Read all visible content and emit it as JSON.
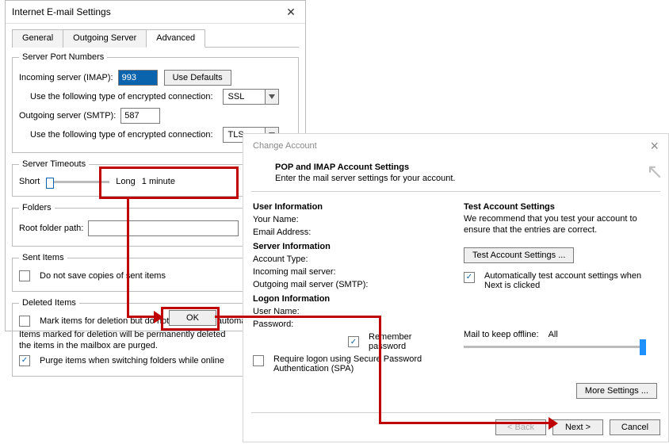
{
  "dlg1": {
    "title": "Internet E-mail Settings",
    "tabs": [
      "General",
      "Outgoing Server",
      "Advanced"
    ],
    "spn": {
      "legend": "Server Port Numbers",
      "incoming_label": "Incoming server (IMAP):",
      "incoming_value": "993",
      "use_defaults": "Use Defaults",
      "enc_label": "Use the following type of encrypted connection:",
      "enc_in": "SSL",
      "outgoing_label": "Outgoing server (SMTP):",
      "outgoing_value": "587",
      "enc_out": "TLS"
    },
    "timeouts": {
      "legend": "Server Timeouts",
      "short": "Short",
      "long": "Long",
      "value": "1 minute"
    },
    "folders": {
      "legend": "Folders",
      "root_label": "Root folder path:"
    },
    "sent": {
      "legend": "Sent Items",
      "opt": "Do not save copies of sent items"
    },
    "deleted": {
      "legend": "Deleted Items",
      "opt1": "Mark items for deletion but do not move them automat",
      "note": "Items marked for deletion will be permanently deleted\nthe items in the mailbox are purged.",
      "opt2": "Purge items when switching folders while online"
    },
    "ok": "OK"
  },
  "dlg2": {
    "title": "Change Account",
    "head": "POP and IMAP Account Settings",
    "subhead": "Enter the mail server settings for your account.",
    "user_info": "User Information",
    "your_name": "Your Name:",
    "email": "Email Address:",
    "server_info": "Server Information",
    "acct_type": "Account Type:",
    "in_server": "Incoming mail server:",
    "out_server": "Outgoing mail server (SMTP):",
    "logon_info": "Logon Information",
    "user_name": "User Name:",
    "password": "Password:",
    "remember": "Remember password",
    "spa": "Require logon using Secure Password Authentication (SPA)",
    "test_head": "Test Account Settings",
    "test_desc": "We recommend that you test your account to ensure that the entries are correct.",
    "test_btn": "Test Account Settings ...",
    "auto_test": "Automatically test account settings when Next is clicked",
    "mail_keep": "Mail to keep offline:",
    "mail_keep_val": "All",
    "more": "More Settings ...",
    "back": "< Back",
    "next": "Next >",
    "cancel": "Cancel"
  }
}
